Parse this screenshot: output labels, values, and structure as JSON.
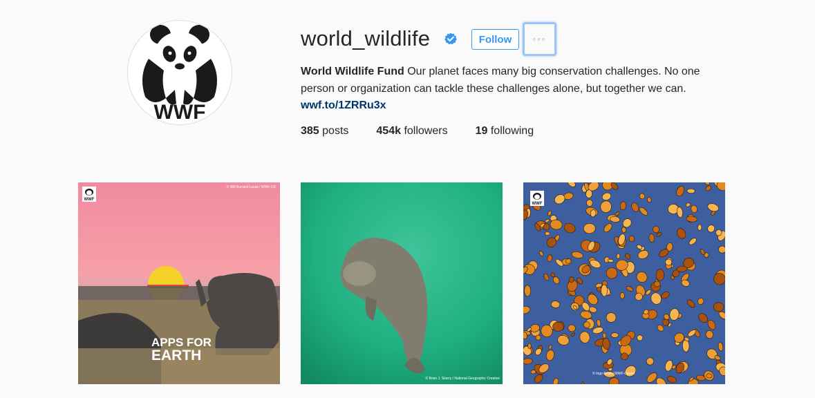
{
  "profile": {
    "username": "world_wildlife",
    "verified": true,
    "follow_label": "Follow",
    "more_label": "◦◦◦",
    "full_name": "World Wildlife Fund",
    "bio": "Our planet faces many big conservation challenges. No one person or organization can tackle these challenges alone, but together we can.",
    "link": "wwf.to/1ZRRu3x",
    "avatar_text": "WWF"
  },
  "stats": [
    {
      "count": "385",
      "label": "posts"
    },
    {
      "count": "454k",
      "label": "followers"
    },
    {
      "count": "19",
      "label": "following"
    }
  ],
  "posts": [
    {
      "subject": "elephants at sunset",
      "overlay_line1": "APPS FOR",
      "overlay_line2": "EARTH",
      "credit": "© Will Burrard-Lucas / WWF-US",
      "badge_text": "WWF"
    },
    {
      "subject": "manatee underwater",
      "credit": "© Brian J. Skerry / National Geographic Creative"
    },
    {
      "subject": "monarch butterflies",
      "credit": "© Ingo Arndt / WWF-Canon",
      "badge_text": "WWF"
    }
  ],
  "colors": {
    "accent": "#3897f0",
    "link": "#003569",
    "background": "#fafafa",
    "text": "#262626"
  }
}
